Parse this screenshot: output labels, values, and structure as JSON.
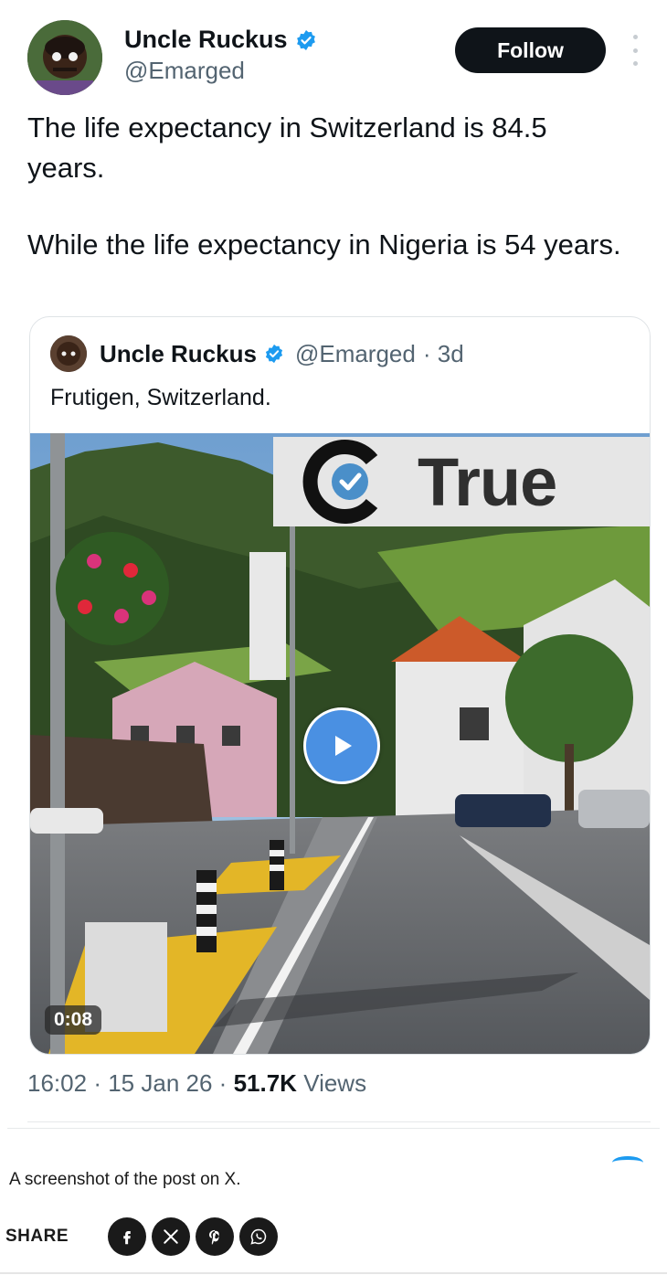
{
  "author": {
    "name": "Uncle Ruckus",
    "handle": "@Emarged",
    "verified": true
  },
  "follow_label": "Follow",
  "tweet": {
    "paragraphs": [
      "The life expectancy in Switzerland is 84.5 years.",
      "While the life expectancy in Nigeria is 54 years."
    ]
  },
  "quoted": {
    "name": "Uncle Ruckus",
    "handle": "@Emarged",
    "age": "· 3d",
    "text": "Frutigen, Switzerland.",
    "video": {
      "overlay_badge": "True",
      "duration": "0:08"
    }
  },
  "meta": {
    "time": "16:02",
    "date": "15 Jan 26",
    "views_count": "51.7K",
    "views_label": "Views",
    "sep": "·"
  },
  "caption": "A screenshot of the post on X.",
  "share": {
    "label": "SHARE",
    "buttons": [
      "facebook-icon",
      "x-icon",
      "pinterest-icon",
      "whatsapp-icon"
    ]
  },
  "colors": {
    "verified_blue": "#1d9bf0",
    "play_blue": "#4a90e2",
    "follow_bg": "#0f1419",
    "secondary_text": "#536471"
  }
}
